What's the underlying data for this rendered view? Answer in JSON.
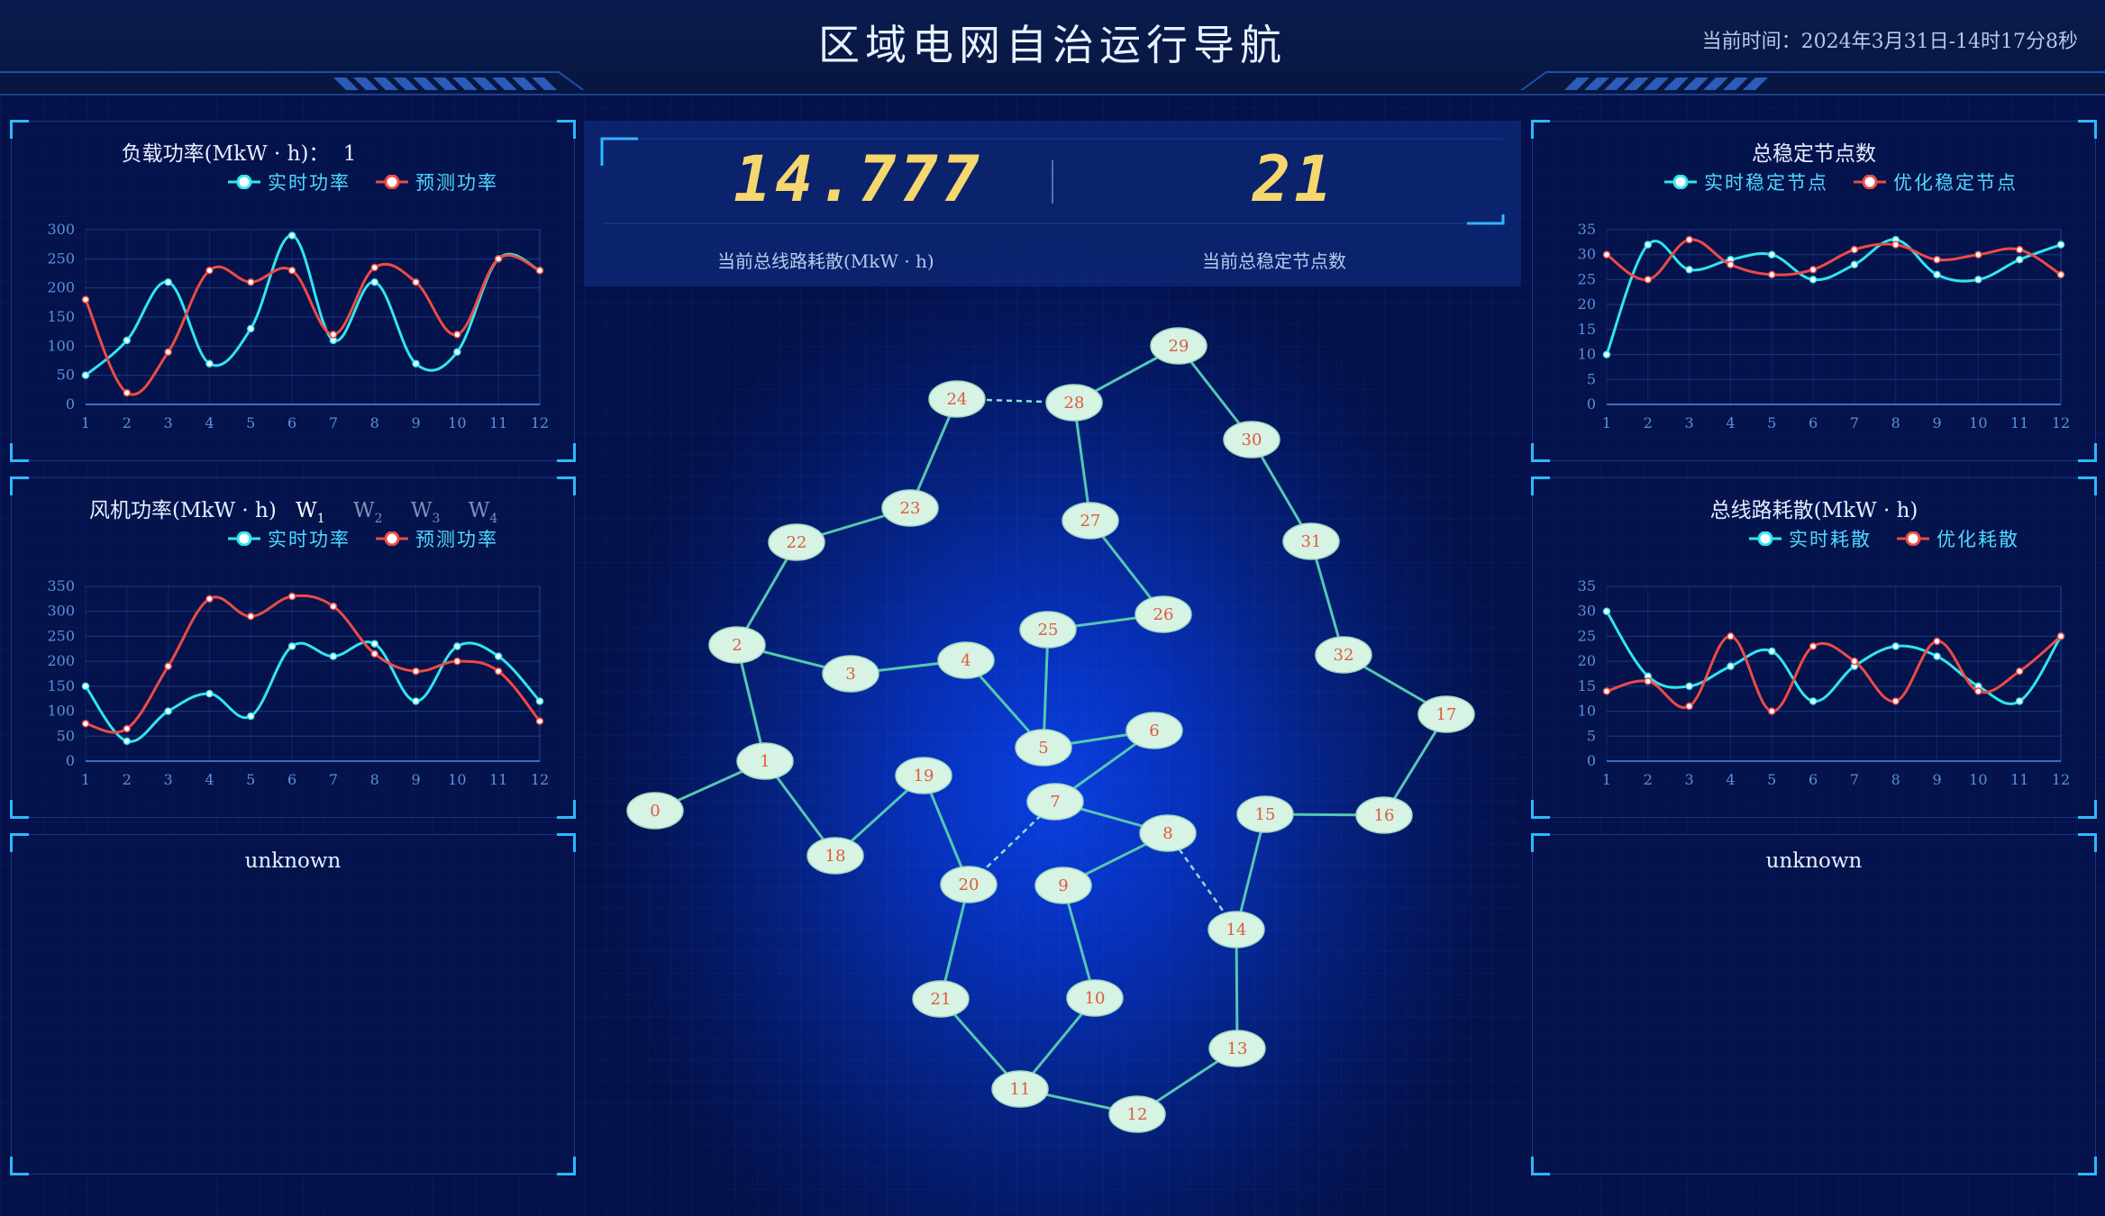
{
  "header": {
    "title": "区域电网自治运行导航",
    "time_label": "当前时间：",
    "time_value": "2024年3月31日-14时17分8秒"
  },
  "colors": {
    "realtime": "#2fe6ee",
    "forecast": "#ee4a44",
    "digit": "#f5d76e",
    "accent": "#2fb8ff"
  },
  "load_panel": {
    "title": "负载功率(MkW · h)：",
    "title_value": "1",
    "legend": [
      "实时功率",
      "预测功率"
    ]
  },
  "wind_panel": {
    "title": "风机功率(MkW · h)",
    "tabs": [
      "W",
      "W",
      "W",
      "W"
    ],
    "tab_subs": [
      "1",
      "2",
      "3",
      "4"
    ],
    "legend": [
      "实时功率",
      "预测功率"
    ]
  },
  "left_bottom_panel": {
    "title": "unknown"
  },
  "stable_panel": {
    "title": "总稳定节点数",
    "legend": [
      "实时稳定节点",
      "优化稳定节点"
    ]
  },
  "loss_panel": {
    "title": "总线路耗散(MkW · h)",
    "legend": [
      "实时耗散",
      "优化耗散"
    ]
  },
  "right_bottom_panel": {
    "title": "unknown"
  },
  "stats": {
    "loss_value": "14.777",
    "loss_label": "当前总线路耗散(MkW · h)",
    "nodes_value": "21",
    "nodes_label": "当前总稳定节点数"
  },
  "chart_data": [
    {
      "id": "load",
      "type": "line",
      "x": [
        1,
        2,
        3,
        4,
        5,
        6,
        7,
        8,
        9,
        10,
        11,
        12
      ],
      "ylim": [
        0,
        300
      ],
      "yticks": [
        0,
        50,
        100,
        150,
        200,
        250,
        300
      ],
      "series": [
        {
          "name": "实时功率",
          "values": [
            50,
            110,
            210,
            70,
            130,
            290,
            110,
            210,
            70,
            90,
            250,
            230
          ]
        },
        {
          "name": "预测功率",
          "values": [
            180,
            20,
            90,
            230,
            210,
            230,
            120,
            235,
            210,
            120,
            250,
            230
          ]
        }
      ]
    },
    {
      "id": "wind",
      "type": "line",
      "x": [
        1,
        2,
        3,
        4,
        5,
        6,
        7,
        8,
        9,
        10,
        11,
        12
      ],
      "ylim": [
        0,
        350
      ],
      "yticks": [
        0,
        50,
        100,
        150,
        200,
        250,
        300,
        350
      ],
      "series": [
        {
          "name": "实时功率",
          "values": [
            150,
            40,
            100,
            135,
            90,
            230,
            210,
            235,
            120,
            230,
            210,
            120
          ]
        },
        {
          "name": "预测功率",
          "values": [
            75,
            65,
            190,
            325,
            290,
            330,
            310,
            215,
            180,
            200,
            180,
            80
          ]
        }
      ]
    },
    {
      "id": "stable",
      "type": "line",
      "x": [
        1,
        2,
        3,
        4,
        5,
        6,
        7,
        8,
        9,
        10,
        11,
        12
      ],
      "ylim": [
        0,
        35
      ],
      "yticks": [
        0,
        5,
        10,
        15,
        20,
        25,
        30,
        35
      ],
      "series": [
        {
          "name": "实时稳定节点",
          "values": [
            10,
            32,
            27,
            29,
            30,
            25,
            28,
            33,
            26,
            25,
            29,
            32
          ]
        },
        {
          "name": "优化稳定节点",
          "values": [
            30,
            25,
            33,
            28,
            26,
            27,
            31,
            32,
            29,
            30,
            31,
            26
          ]
        }
      ]
    },
    {
      "id": "loss",
      "type": "line",
      "x": [
        1,
        2,
        3,
        4,
        5,
        6,
        7,
        8,
        9,
        10,
        11,
        12
      ],
      "ylim": [
        0,
        35
      ],
      "yticks": [
        0,
        5,
        10,
        15,
        20,
        25,
        30,
        35
      ],
      "series": [
        {
          "name": "实时耗散",
          "values": [
            30,
            17,
            15,
            19,
            22,
            12,
            19,
            23,
            21,
            15,
            12,
            25
          ]
        },
        {
          "name": "优化耗散",
          "values": [
            14,
            16,
            11,
            25,
            10,
            23,
            20,
            12,
            24,
            14,
            18,
            25
          ]
        }
      ]
    }
  ],
  "graph": {
    "nodes": [
      "0",
      "1",
      "2",
      "3",
      "4",
      "5",
      "6",
      "7",
      "8",
      "9",
      "10",
      "11",
      "12",
      "13",
      "14",
      "15",
      "16",
      "17",
      "18",
      "19",
      "20",
      "21",
      "22",
      "23",
      "24",
      "25",
      "26",
      "27",
      "28",
      "29",
      "30",
      "31",
      "32"
    ]
  }
}
